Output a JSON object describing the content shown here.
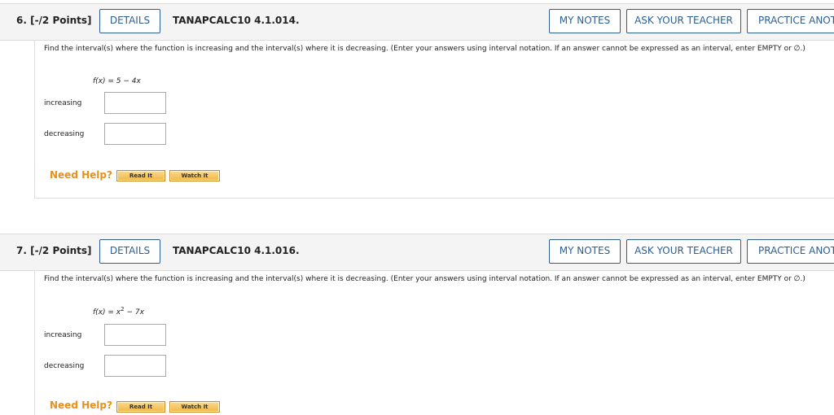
{
  "questions": [
    {
      "number_label": "6.  [-/2 Points]",
      "details_label": "DETAILS",
      "question_id": "TANAPCALC10 4.1.014.",
      "my_notes_label": "MY NOTES",
      "ask_teacher_label": "ASK YOUR TEACHER",
      "practice_label": "PRACTICE ANOTHER",
      "prompt": "Find the interval(s) where the function is increasing and the interval(s) where it is decreasing. (Enter your answers using interval notation. If an answer cannot be expressed as an interval, enter EMPTY or ∅.)",
      "function_prefix": "f(x) = 5 − 4x",
      "function_superscript": "",
      "function_suffix": "",
      "increasing_label": "increasing",
      "increasing_value": "",
      "decreasing_label": "decreasing",
      "decreasing_value": "",
      "need_help_label": "Need Help?",
      "read_it_label": "Read It",
      "watch_it_label": "Watch It"
    },
    {
      "number_label": "7.  [-/2 Points]",
      "details_label": "DETAILS",
      "question_id": "TANAPCALC10 4.1.016.",
      "my_notes_label": "MY NOTES",
      "ask_teacher_label": "ASK YOUR TEACHER",
      "practice_label": "PRACTICE ANOTHER",
      "prompt": "Find the interval(s) where the function is increasing and the interval(s) where it is decreasing. (Enter your answers using interval notation. If an answer cannot be expressed as an interval, enter EMPTY or ∅.)",
      "function_prefix": "f(x) = x",
      "function_superscript": "2",
      "function_suffix": " − 7x",
      "increasing_label": "increasing",
      "increasing_value": "",
      "decreasing_label": "decreasing",
      "decreasing_value": "",
      "need_help_label": "Need Help?",
      "read_it_label": "Read It",
      "watch_it_label": "Watch It"
    }
  ]
}
